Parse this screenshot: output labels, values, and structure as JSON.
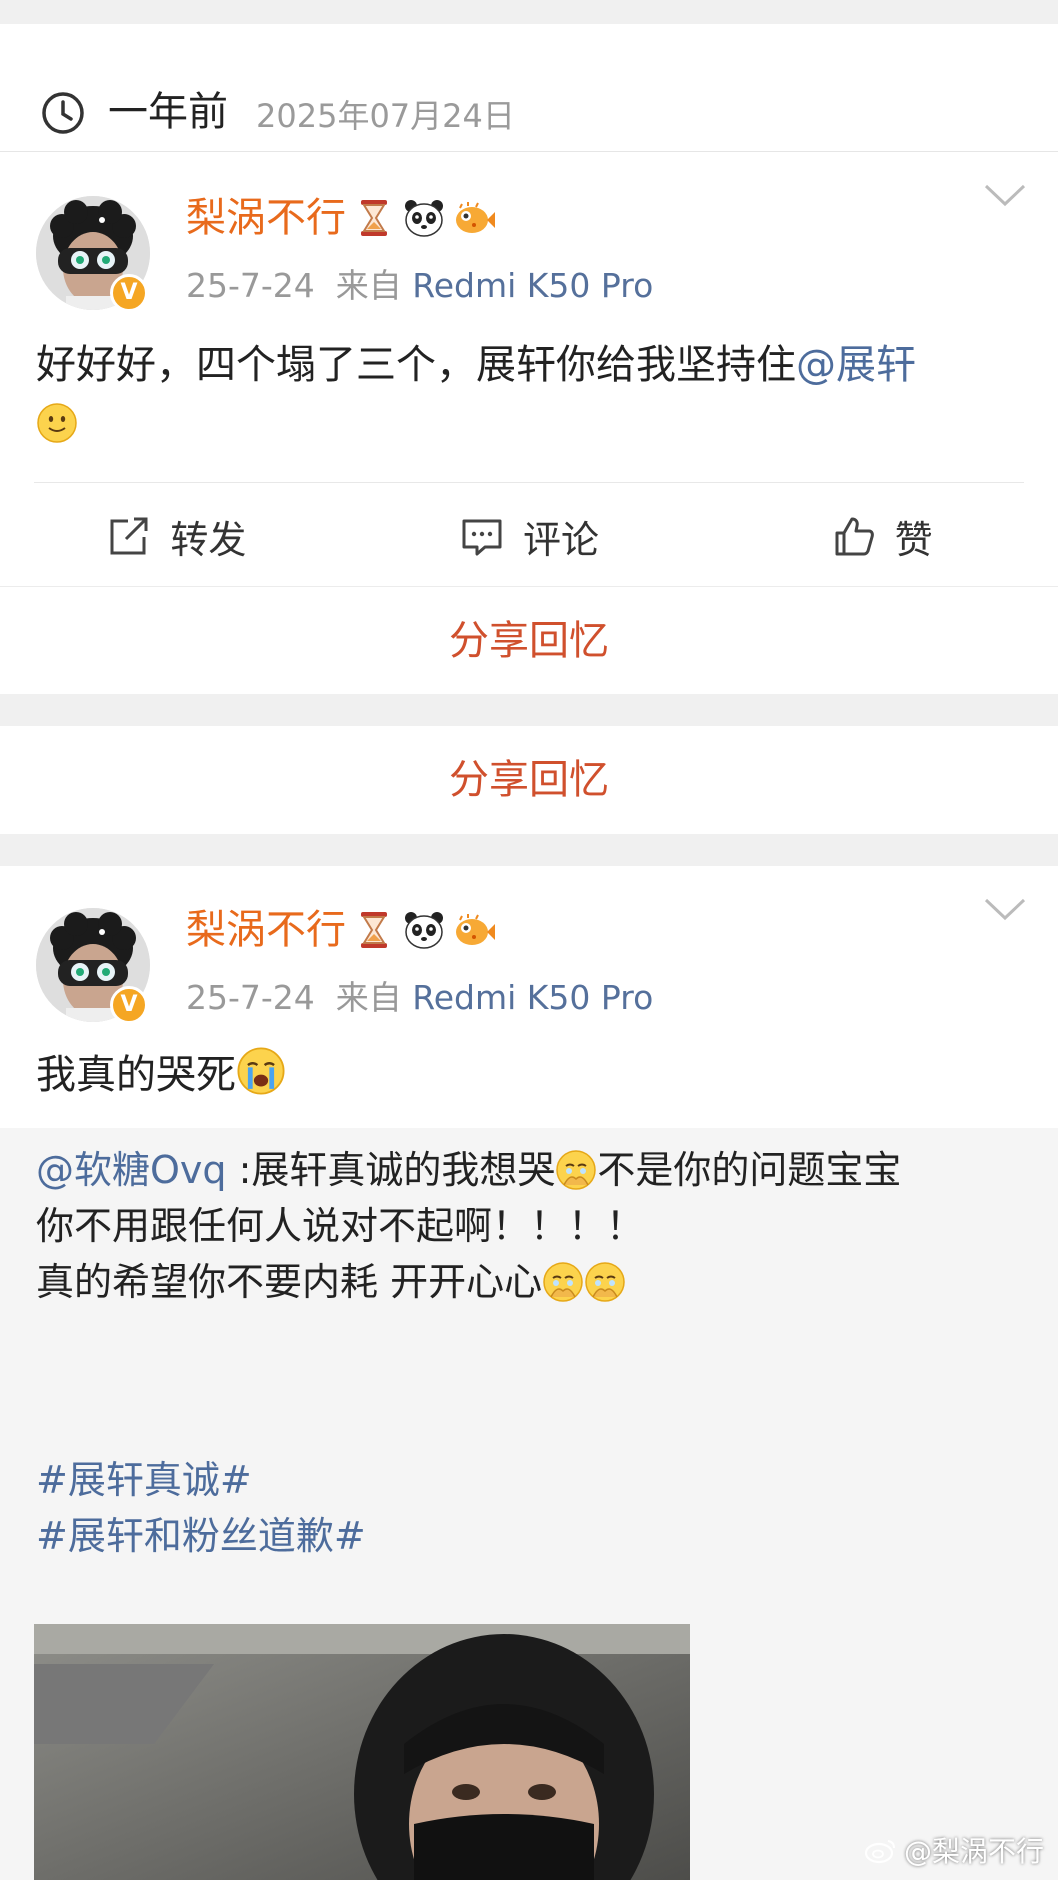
{
  "memory": {
    "ago": "一年前",
    "date": "2025年07月24日"
  },
  "posts": [
    {
      "username": "梨涡不行",
      "time": "25-7-24",
      "from_label": "来自",
      "source": "Redmi K50 Pro",
      "text": "好好好，四个塌了三个，展轩你给我坚持住",
      "mention": "@展轩",
      "verified_badge": "V"
    },
    {
      "username": "梨涡不行",
      "time": "25-7-24",
      "from_label": "来自",
      "source": "Redmi K50 Pro",
      "text": "我真的哭死",
      "verified_badge": "V",
      "retweet": {
        "mention": "@软糖Ovq",
        "line1": " :展轩真诚的我想哭",
        "line1b": "不是你的问题宝宝",
        "line2": "你不用跟任何人说对不起啊！！！！",
        "line3": "真的希望你不要内耗 开开心心",
        "topics": [
          "#展轩真诚#",
          "#展轩和粉丝道歉#"
        ]
      }
    }
  ],
  "actions": {
    "repost": "转发",
    "comment": "评论",
    "like": "赞"
  },
  "share_memory": "分享回忆",
  "watermark": "@梨涡不行",
  "colors": {
    "username": "#e86a1c",
    "link": "#4d6c9c",
    "share": "#d0502d",
    "meta": "#999999"
  },
  "icons": [
    "clock-icon",
    "hourglass-icon",
    "panda-icon",
    "pufferfish-icon",
    "chevron-down-icon",
    "repost-icon",
    "comment-icon",
    "like-icon",
    "smile-emoji",
    "crying-emoji",
    "holding-tears-emoji",
    "weibo-logo-icon"
  ]
}
